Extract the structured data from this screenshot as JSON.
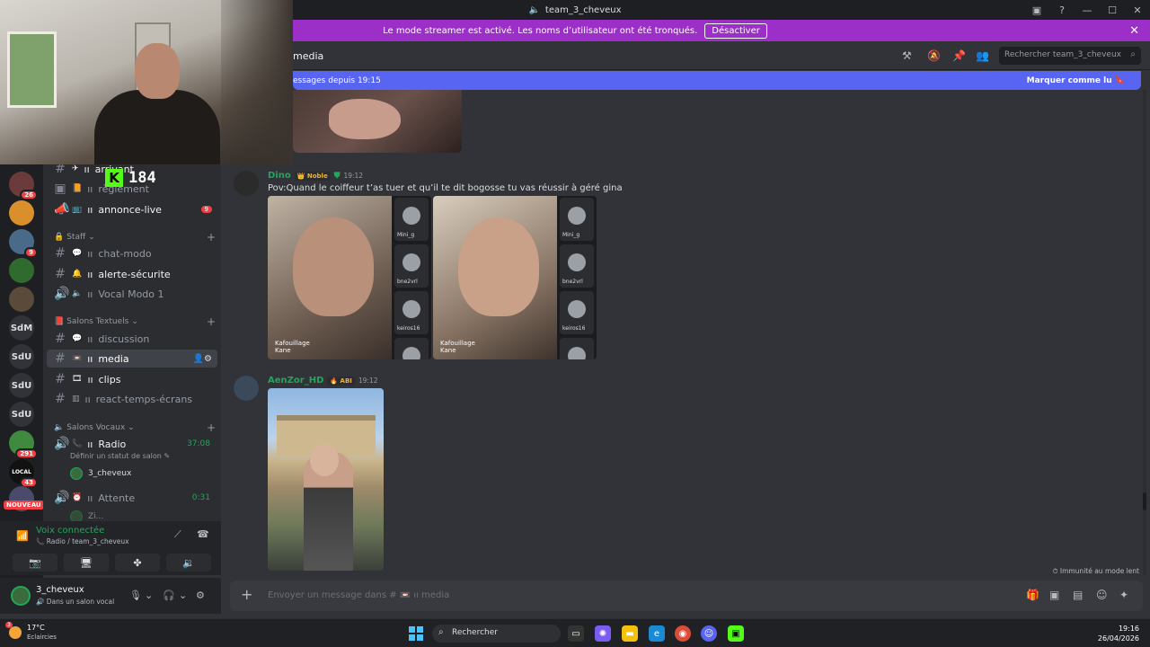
{
  "window": {
    "title": "team_3_cheveux",
    "controls": [
      "▣",
      "?",
      "—",
      "☐",
      "✕"
    ]
  },
  "streamer_banner": {
    "text": "Le mode streamer est activé. Les noms d’utilisateur ont été tronqués.",
    "button": "Désactiver",
    "close": "✕"
  },
  "overlay": {
    "viewer_count": "184",
    "k_label": "K"
  },
  "servers": [
    {
      "label": "",
      "badge": "26"
    },
    {
      "label": "",
      "badge": ""
    },
    {
      "label": "",
      "badge": "9"
    },
    {
      "label": "",
      "badge": ""
    },
    {
      "label": "",
      "badge": ""
    },
    {
      "label": "SdM",
      "badge": ""
    },
    {
      "label": "SdU",
      "badge": ""
    },
    {
      "label": "SdU",
      "badge": ""
    },
    {
      "label": "SdU",
      "badge": ""
    },
    {
      "label": "",
      "badge": "291"
    },
    {
      "label": "LOCAL",
      "badge": "43"
    },
    {
      "label": "",
      "badge": ""
    }
  ],
  "server_new_label": "NOUVEAU",
  "channels": {
    "top": [
      {
        "name": "arrivant",
        "prefix": "✈",
        "bright": true
      },
      {
        "name": "règlement",
        "prefix": "📙",
        "bright": false
      },
      {
        "name": "annonce-live",
        "prefix": "📺",
        "bright": true,
        "badge": "9"
      }
    ],
    "cat_staff": "Staff",
    "staff": [
      {
        "name": "chat-modo",
        "prefix": "💬",
        "bright": false
      },
      {
        "name": "alerte-sécurite",
        "prefix": "🔔",
        "bright": true
      },
      {
        "name": "Vocal Modo 1",
        "prefix": "🔈",
        "bright": false
      }
    ],
    "cat_text": "Salons Textuels",
    "text": [
      {
        "name": "discussion",
        "prefix": "💬",
        "bright": false
      },
      {
        "name": "media",
        "prefix": "📼",
        "bright": true
      },
      {
        "name": "clips",
        "prefix": "🎞",
        "bright": true
      },
      {
        "name": "react-temps-écrans",
        "prefix": "▥",
        "bright": false
      }
    ],
    "cat_voice": "Salons Vocaux",
    "voice": {
      "radio_name": "Radio",
      "radio_time": "37:08",
      "radio_status": "Définir un statut de salon ✎",
      "radio_user": "3_cheveux",
      "wait_name": "Attente",
      "wait_time": "0:31",
      "wait_user": "Zi..."
    }
  },
  "voice_panel": {
    "title": "Voix connectée",
    "sub": "Radio / team_3_cheveux"
  },
  "user_panel": {
    "name": "3_cheveux",
    "status": "Dans un salon vocal"
  },
  "header": {
    "channel": "media",
    "search_placeholder": "Rechercher team_3_cheveux"
  },
  "new_messages": {
    "text": "essages depuis 19:15",
    "mark": "Marquer comme lu"
  },
  "messages": [
    {
      "author": "Dino",
      "tag": "Noble",
      "time": "19:12",
      "text": "Pov:Quand le coiffeur t’as tuer et qu’il te dit bogosse tu vas réussir à géré gina",
      "videos": [
        {
          "overlay_top": "Kafouillage",
          "overlay_bottom": "Kane",
          "tiles": [
            "Mini_g",
            "bne2vrl",
            "keiros16",
            ""
          ]
        },
        {
          "overlay_top": "Kafouillage",
          "overlay_bottom": "Kane",
          "tiles": [
            "Mini_g",
            "bne2vrl",
            "keiros16",
            ""
          ]
        }
      ]
    },
    {
      "author": "AenZor_HD",
      "tag": "ABI",
      "time": "19:12"
    }
  ],
  "immunity": "Immunité au mode lent",
  "composer": {
    "placeholder": "Envoyer un message dans # 📼 ıı media"
  },
  "taskbar": {
    "temp": "17°C",
    "weather": "Eclaircies",
    "weather_badge": "3",
    "search": "Rechercher",
    "time": "19:16",
    "date": "26/04/2026"
  },
  "colors": {
    "accent": "#5865f2",
    "streamer": "#9b2fc8",
    "green": "#23a55a",
    "red": "#f23f43"
  }
}
